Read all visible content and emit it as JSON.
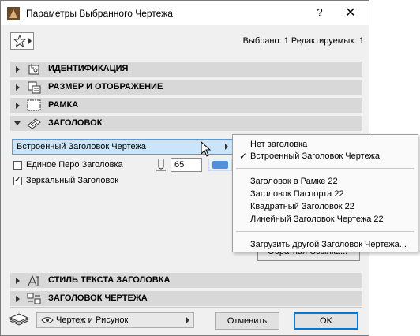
{
  "window": {
    "title": "Параметры Выбранного Чертежа",
    "help_label": "?",
    "close_label": "✕"
  },
  "toolbar": {
    "selection_status": "Выбрано: 1 Редактируемых: 1"
  },
  "sections": {
    "identification": "ИДЕНТИФИКАЦИЯ",
    "size_display": "РАЗМЕР И ОТОБРАЖЕНИЕ",
    "frame": "РАМКА",
    "title": "ЗАГОЛОВОК",
    "title_text_style": "СТИЛЬ ТЕКСТА ЗАГОЛОВКА",
    "drawing_title": "ЗАГОЛОВОК ЧЕРТЕЖА"
  },
  "title_settings": {
    "title_type_value": "Встроенный Заголовок Чертежа",
    "uniform_pen_label": "Единое Перо Заголовка",
    "uniform_pen_checked": false,
    "pen_value": "65",
    "pen_color": "#4f8fdc",
    "mirrored_label": "Зеркальный Заголовок",
    "mirrored_checked": true
  },
  "title_menu": {
    "item_none": "Нет заголовка",
    "item_builtin": "Встроенный Заголовок Чертежа",
    "item_frame": "Заголовок в Рамке 22",
    "item_passport": "Заголовок Паспорта 22",
    "item_square": "Квадратный Заголовок 22",
    "item_linear": "Линейный Заголовок Чертежа 22",
    "item_load": "Загрузить другой Заголовок Чертежа..."
  },
  "cross_reference_label": "Обратная Ссылка...",
  "footer": {
    "view_select_value": "Чертеж и Рисунок",
    "cancel_label": "Отменить",
    "ok_label": "OK"
  },
  "colors": {
    "selection_bg": "#cce4f7",
    "section_bg": "#d8d8d8",
    "ok_border": "#0078d7"
  }
}
